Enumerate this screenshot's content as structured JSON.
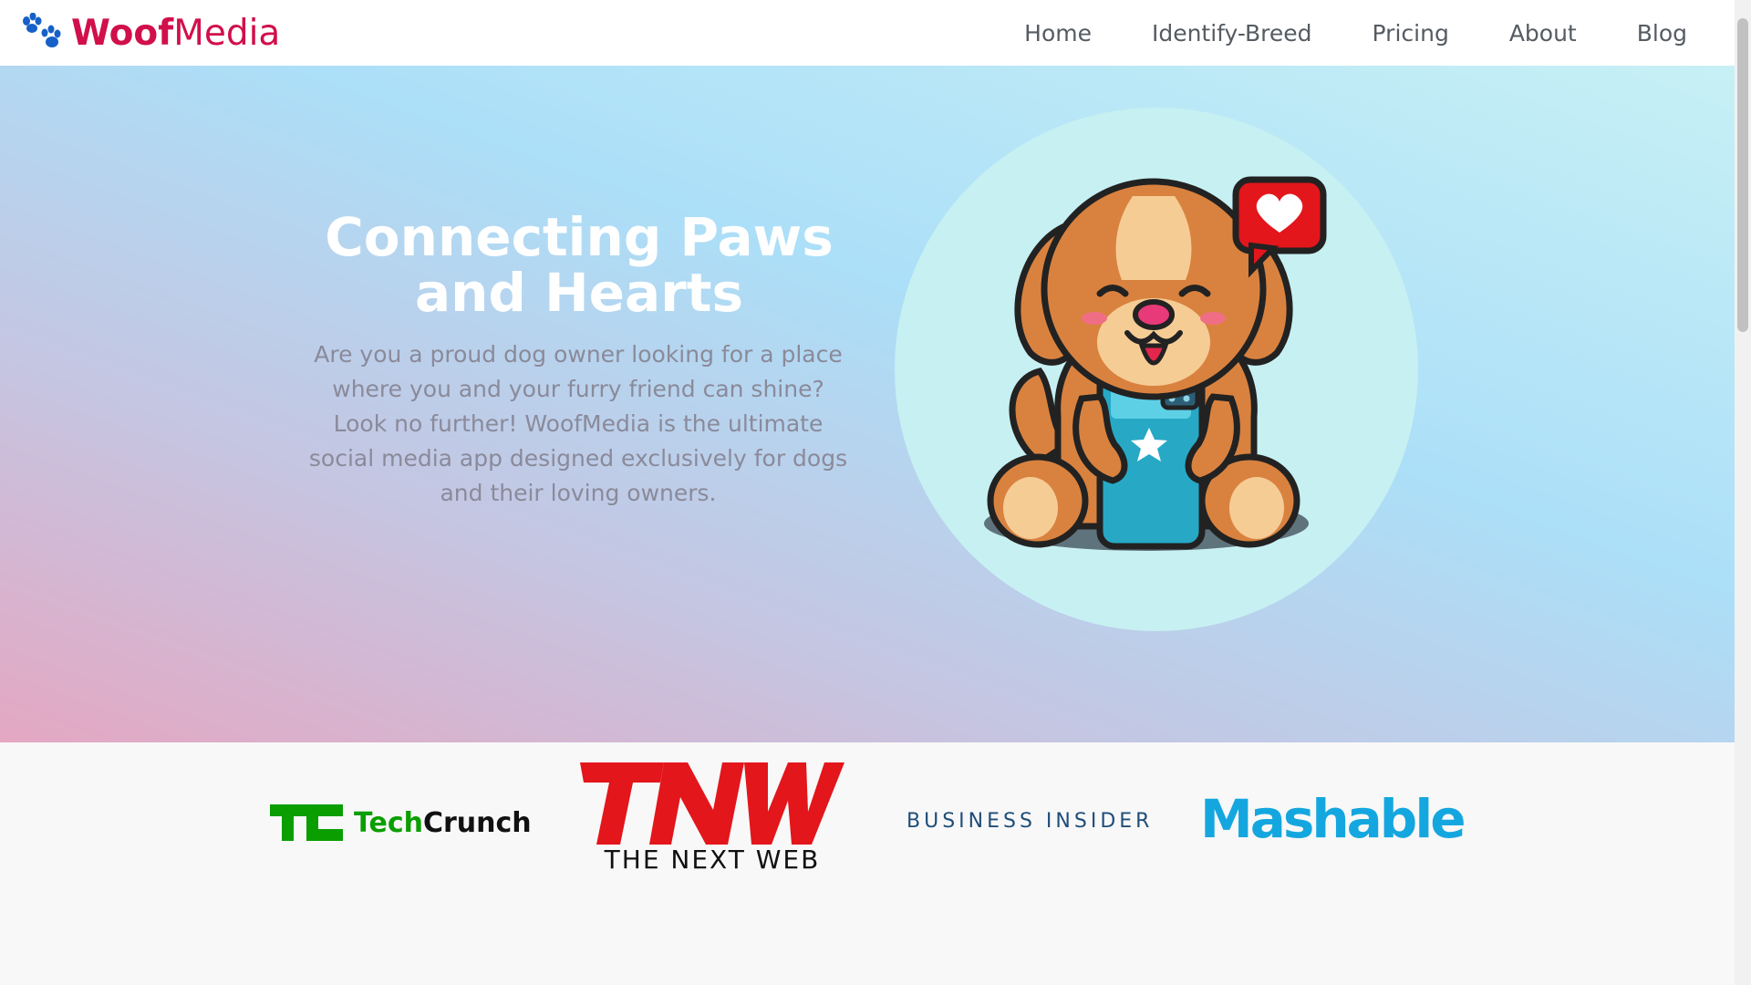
{
  "brand": {
    "name_bold": "Woof",
    "name_light": "Media",
    "color": "#d10f4b"
  },
  "nav": {
    "items": [
      {
        "label": "Home"
      },
      {
        "label": "Identify-Breed"
      },
      {
        "label": "Pricing"
      },
      {
        "label": "About"
      },
      {
        "label": "Blog"
      }
    ]
  },
  "hero": {
    "title": "Connecting Paws and Hearts",
    "description": "Are you a proud dog owner looking for a place where you and your furry friend can shine? Look no further! WoofMedia is the ultimate social media app designed exclusively for dogs and their loving owners.",
    "illustration": "dog-with-phone-illustration"
  },
  "press": {
    "logos": [
      {
        "name": "TechCrunch",
        "part1": "Tech",
        "part2": "Crunch",
        "color": "#0a9e01"
      },
      {
        "name": "TNW",
        "subtitle": "THE NEXT WEB",
        "color": "#e3161b"
      },
      {
        "name": "BUSINESS INSIDER",
        "color": "#1f4e79"
      },
      {
        "name": "Mashable",
        "color": "#14a7df"
      }
    ]
  }
}
